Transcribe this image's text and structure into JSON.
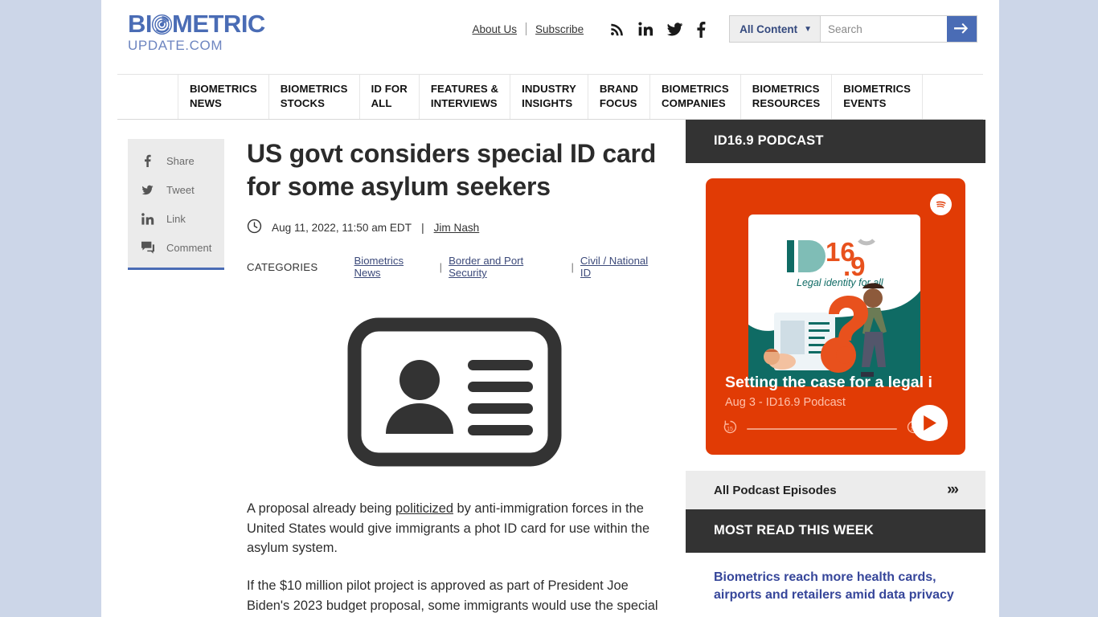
{
  "site": {
    "logo_main": "BIOMETRIC",
    "logo_sub": "UPDATE.COM"
  },
  "topbar": {
    "links": [
      {
        "label": "About Us"
      },
      {
        "label": "Subscribe"
      }
    ],
    "socials": [
      {
        "name": "rss-icon"
      },
      {
        "name": "linkedin-icon"
      },
      {
        "name": "twitter-icon"
      },
      {
        "name": "facebook-icon"
      }
    ],
    "search": {
      "selected_filter": "All Content",
      "placeholder": "Search",
      "value": "",
      "submit_label": "→"
    }
  },
  "mainnav": {
    "items": [
      {
        "label": "BIOMETRICS\nNEWS"
      },
      {
        "label": "BIOMETRICS\nSTOCKS"
      },
      {
        "label": "ID FOR\nALL"
      },
      {
        "label": "FEATURES &\nINTERVIEWS"
      },
      {
        "label": "INDUSTRY\nINSIGHTS"
      },
      {
        "label": "BRAND\nFOCUS"
      },
      {
        "label": "BIOMETRICS\nCOMPANIES"
      },
      {
        "label": "BIOMETRICS\nRESOURCES"
      },
      {
        "label": "BIOMETRICS\nEVENTS"
      }
    ]
  },
  "share": {
    "items": [
      {
        "icon": "facebook-icon",
        "label": "Share"
      },
      {
        "icon": "twitter-icon",
        "label": "Tweet"
      },
      {
        "icon": "linkedin-icon",
        "label": "Link"
      },
      {
        "icon": "comment-icon",
        "label": "Comment"
      }
    ]
  },
  "article": {
    "headline": "US govt considers special ID card for some asylum seekers",
    "date": "Aug 11, 2022, 11:50 am EDT",
    "byline_sep": "|",
    "author": "Jim Nash",
    "categories_label": "CATEGORIES",
    "categories": [
      {
        "label": "Biometrics News"
      },
      {
        "label": "Border and Port Security"
      },
      {
        "label": "Civil / National ID"
      }
    ],
    "hero_image_alt": "id-card-illustration",
    "paragraphs": [
      {
        "before": "A proposal already being ",
        "link": "politicized",
        "after": " by anti-immigration forces in the United States would give immigrants a phot ID card for use within the asylum system."
      },
      {
        "before": "If the $10 million pilot project is approved as part of President Joe Biden's 2023 budget proposal, some immigrants would use the special",
        "link": "",
        "after": ""
      }
    ]
  },
  "sidebar": {
    "podcast_widget": {
      "heading": "ID16.9 PODCAST",
      "platform": "spotify-icon",
      "artwork": {
        "logo_id": "ID",
        "logo_num_top": "16",
        "logo_num_bottom": "9",
        "tagline": "Legal identity for all"
      },
      "episode_title": "Setting the case for a legal i",
      "episode_meta": "Aug 3 - ID16.9 Podcast",
      "rewind_label": "15",
      "forward_label": "15",
      "more_label": "•••"
    },
    "all_episodes": {
      "label": "All Podcast Episodes",
      "chevron": "»›"
    },
    "most_read": {
      "heading": "MOST READ THIS WEEK",
      "items": [
        {
          "title": "Biometrics reach more health cards, airports and retailers amid data privacy"
        }
      ]
    }
  },
  "colors": {
    "brand_blue": "#4a6cb5",
    "dark_header": "#333333",
    "podcast_orange": "#e13b05",
    "link_navy": "#36469a"
  }
}
